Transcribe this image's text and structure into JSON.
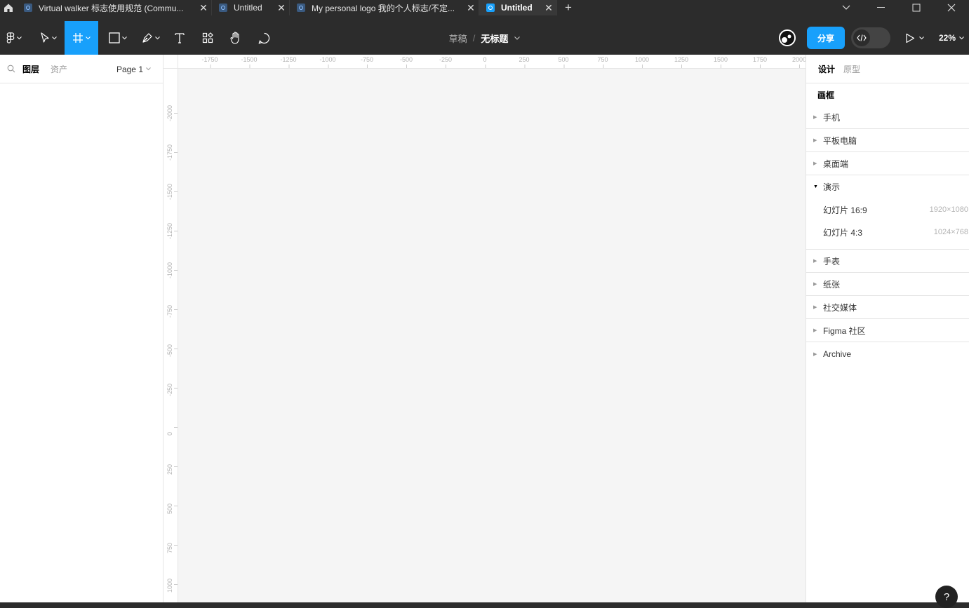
{
  "tabs": [
    {
      "label": "Virtual walker 标志使用规范 (Commu...",
      "active": false
    },
    {
      "label": "Untitled",
      "active": false
    },
    {
      "label": "My personal logo 我的个人标志/不定...",
      "active": false
    },
    {
      "label": "Untitled",
      "active": true
    }
  ],
  "toolbar": {
    "project": "草稿",
    "separator": "/",
    "file_name": "无标题",
    "share_label": "分享",
    "zoom": "22%"
  },
  "left_panel": {
    "tab_layers": "图层",
    "tab_assets": "资产",
    "page": "Page 1"
  },
  "rulers": {
    "horizontal": [
      "-1750",
      "-1500",
      "-1250",
      "-1000",
      "-750",
      "-500",
      "-250",
      "0",
      "250",
      "500",
      "750",
      "1000",
      "1250",
      "1500",
      "1750",
      "2000"
    ],
    "vertical": [
      "-2000",
      "-1750",
      "-1500",
      "-1250",
      "-1000",
      "-750",
      "-500",
      "-250",
      "0",
      "250",
      "500",
      "750",
      "1000"
    ]
  },
  "right_panel": {
    "tab_design": "设计",
    "tab_prototype": "原型",
    "section_title": "画框",
    "categories": [
      {
        "label": "手机",
        "open": false
      },
      {
        "label": "平板电脑",
        "open": false
      },
      {
        "label": "桌面端",
        "open": false
      },
      {
        "label": "演示",
        "open": true,
        "presets": [
          {
            "label": "幻灯片 16:9",
            "size": "1920×1080"
          },
          {
            "label": "幻灯片 4:3",
            "size": "1024×768"
          }
        ]
      },
      {
        "label": "手表",
        "open": false
      },
      {
        "label": "纸张",
        "open": false
      },
      {
        "label": "社交媒体",
        "open": false
      },
      {
        "label": "Figma 社区",
        "open": false
      },
      {
        "label": "Archive",
        "open": false
      }
    ]
  },
  "help_label": "?",
  "colors": {
    "accent": "#18a0fb",
    "toolbar_bg": "#2c2c2c",
    "canvas_bg": "#f5f5f5"
  }
}
